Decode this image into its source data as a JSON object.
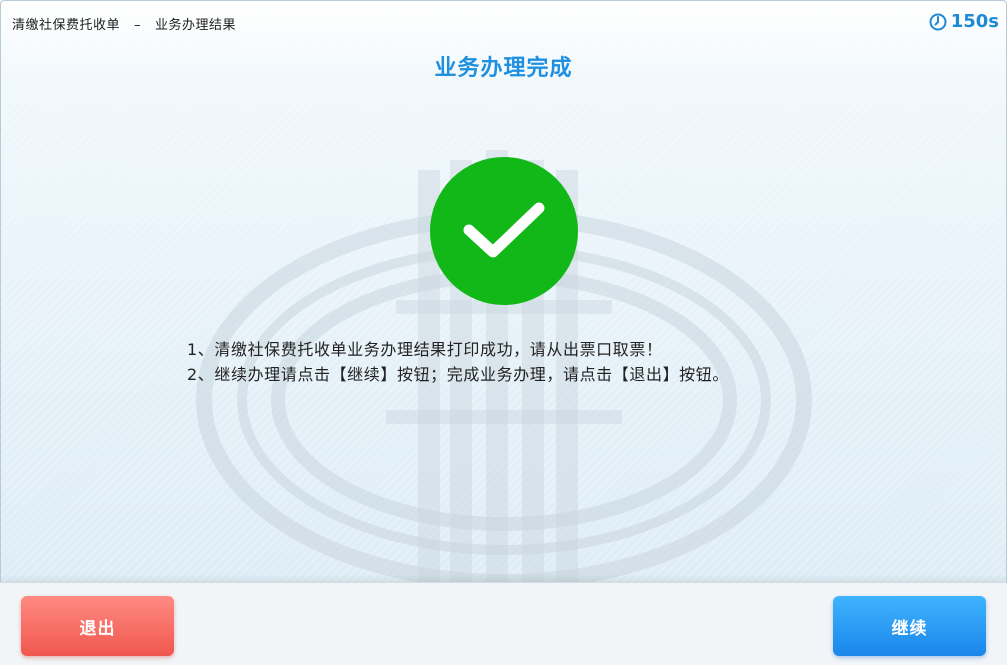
{
  "header": {
    "breadcrumb_section": "清缴社保费托收单",
    "breadcrumb_separator": "–",
    "breadcrumb_page": "业务办理结果",
    "countdown": "150s"
  },
  "main": {
    "title": "业务办理完成",
    "messages": [
      "1、清缴社保费托收单业务办理结果打印成功，请从出票口取票！",
      "2、继续办理请点击【继续】按钮；完成业务办理，请点击【退出】按钮。"
    ]
  },
  "footer": {
    "exit_label": "退出",
    "continue_label": "继续"
  },
  "colors": {
    "title": "#1f8fe0",
    "timer": "#1e8ad6",
    "success_circle": "#12b818",
    "exit_button": "#f0574e",
    "continue_button": "#1a86ea"
  },
  "icons": {
    "timer": "clock-icon",
    "status": "checkmark-icon",
    "watermark": "tax-emblem-watermark"
  }
}
